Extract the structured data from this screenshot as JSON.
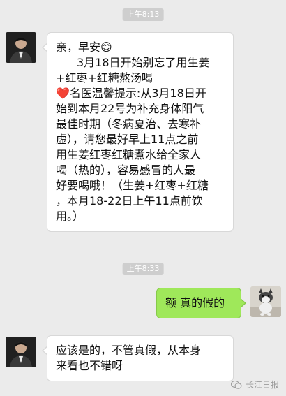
{
  "timestamps": [
    "上午8:13",
    "上午8:33"
  ],
  "messages": [
    {
      "side": "left",
      "sender": "friend",
      "lines": [
        "亲，早安😊",
        "3月18日开始别忘了用生姜",
        "+红枣+红糖熬汤喝",
        "❤️名医温馨提示:从3月18日开",
        "始到本月22号为补充身体阳气",
        "最佳时期（冬病夏治、去寒补",
        "虚），请您最好早上11点之前",
        "用生姜红枣红糖煮水给全家人",
        "喝（热的），容易感冒的人最",
        "好要喝哦！（生姜+红枣+红糖",
        "，本月18-22日上午11点前饮",
        "用。）"
      ]
    },
    {
      "side": "right",
      "sender": "me",
      "lines": [
        "额 真的假的"
      ]
    },
    {
      "side": "left",
      "sender": "friend",
      "lines": [
        "应该是的，不管真假，从本身",
        "来看也不错呀"
      ]
    }
  ],
  "watermark": {
    "text": "长江日报",
    "icon": "wechat-icon"
  },
  "colors": {
    "background": "#ebebeb",
    "my_bubble": "#9fe85a",
    "friend_bubble": "#ffffff",
    "timestamp_bg": "#cecece"
  }
}
